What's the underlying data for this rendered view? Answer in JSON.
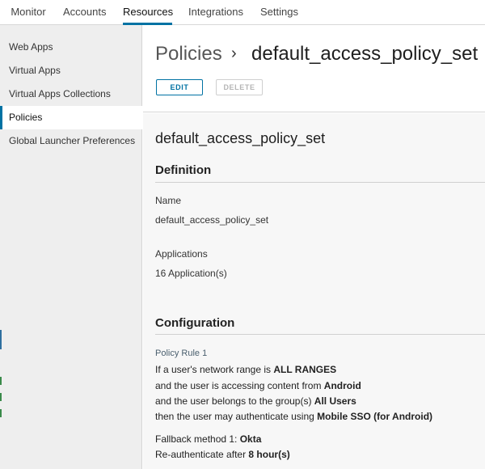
{
  "topnav": {
    "tabs": [
      {
        "label": "Monitor"
      },
      {
        "label": "Accounts"
      },
      {
        "label": "Resources"
      },
      {
        "label": "Integrations"
      },
      {
        "label": "Settings"
      }
    ]
  },
  "sidebar": {
    "items": [
      {
        "label": "Web Apps"
      },
      {
        "label": "Virtual Apps"
      },
      {
        "label": "Virtual Apps Collections"
      },
      {
        "label": "Policies"
      },
      {
        "label": "Global Launcher Preferences"
      }
    ]
  },
  "header": {
    "breadcrumb_root": "Policies",
    "breadcrumb_separator": "›",
    "breadcrumb_current": "default_access_policy_set",
    "edit_label": "EDIT",
    "delete_label": "DELETE"
  },
  "content": {
    "policy_title": "default_access_policy_set",
    "definition": {
      "heading": "Definition",
      "name_label": "Name",
      "name_value": "default_access_policy_set",
      "applications_label": "Applications",
      "applications_value": "16 Application(s)"
    },
    "configuration": {
      "heading": "Configuration",
      "rule_name": "Policy Rule 1",
      "line1_prefix": "If a user's network range is ",
      "line1_value": "ALL RANGES",
      "line2_prefix": "and the user is accessing content from ",
      "line2_value": "Android",
      "line3_prefix": "and the user belongs to the group(s) ",
      "line3_value": "All Users",
      "line4_prefix": "then the user may authenticate using ",
      "line4_value": "Mobile SSO (for Android)",
      "fallback_prefix": "Fallback method 1: ",
      "fallback_value": "Okta",
      "reauth_prefix": "Re-authenticate after ",
      "reauth_value": "8 hour(s)"
    }
  },
  "colors": {
    "accent": "#0072a3",
    "sidebar_bg": "#eeeeee",
    "content_bg": "#f7f7f7"
  }
}
